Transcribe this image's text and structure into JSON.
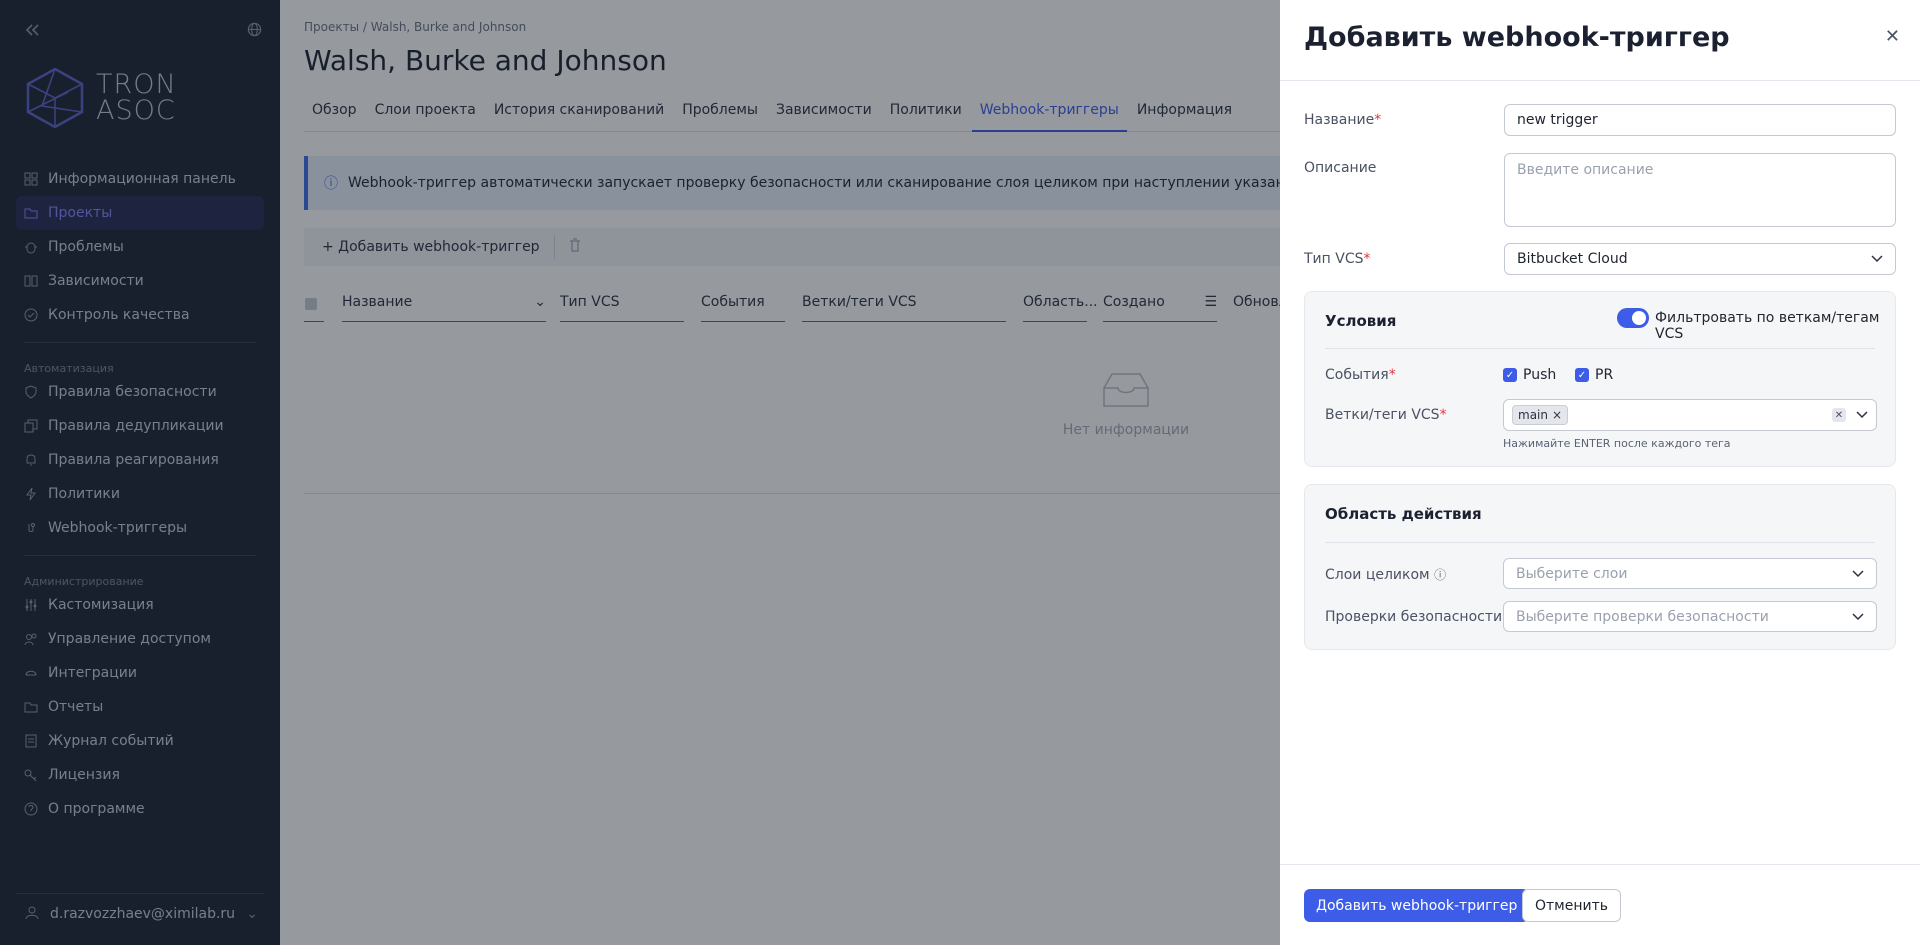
{
  "sidebar": {
    "collapse_icon": "double-chevron-left-icon",
    "language_icon": "globe-icon",
    "logo_text_1": "TRON",
    "logo_text_2": "ASOC",
    "items_top": [
      {
        "label": "Информационная панель",
        "icon": "dashboard-icon"
      },
      {
        "label": "Проекты",
        "icon": "folder-icon",
        "active": true
      },
      {
        "label": "Проблемы",
        "icon": "bug-icon"
      },
      {
        "label": "Зависимости",
        "icon": "book-icon"
      },
      {
        "label": "Контроль качества",
        "icon": "check-circle-icon"
      }
    ],
    "section_automation": "Автоматизация",
    "items_automation": [
      {
        "label": "Правила безопасности",
        "icon": "shield-icon"
      },
      {
        "label": "Правила дедупликации",
        "icon": "copy-icon"
      },
      {
        "label": "Правила реагирования",
        "icon": "bell-icon"
      },
      {
        "label": "Политики",
        "icon": "bolt-icon"
      },
      {
        "label": "Webhook-триггеры",
        "icon": "webhook-icon"
      }
    ],
    "section_admin": "Администрирование",
    "items_admin": [
      {
        "label": "Кастомизация",
        "icon": "sliders-icon"
      },
      {
        "label": "Управление доступом",
        "icon": "users-icon"
      },
      {
        "label": "Интеграции",
        "icon": "integration-icon"
      },
      {
        "label": "Отчеты",
        "icon": "folder-icon"
      },
      {
        "label": "Журнал событий",
        "icon": "list-icon"
      },
      {
        "label": "Лицензия",
        "icon": "key-icon"
      },
      {
        "label": "О программе",
        "icon": "help-circle-icon"
      }
    ],
    "user_email": "d.razvozzhaev@ximilab.ru"
  },
  "main": {
    "breadcrumb_root": "Проекты",
    "breadcrumb_sep": "/",
    "breadcrumb_current": "Walsh, Burke and Johnson",
    "title": "Walsh, Burke and Johnson",
    "tabs": [
      "Обзор",
      "Слои проекта",
      "История сканирований",
      "Проблемы",
      "Зависимости",
      "Политики",
      "Webhook-триггеры",
      "Информация"
    ],
    "active_tab": "Webhook-триггеры",
    "info_text": "Webhook-триггер автоматически запускает проверку безопасности или сканирование слоя целиком при наступлении указанных событий в VCS",
    "add_button": "+ Добавить webhook-триггер",
    "columns": [
      "Название",
      "Тип VCS",
      "События",
      "Ветки/теги VCS",
      "Область...",
      "Создано",
      "Обновл"
    ],
    "empty_text": "Нет информации"
  },
  "drawer": {
    "title": "Добавить webhook-триггер",
    "name_label": "Название",
    "name_value": "new trigger",
    "description_label": "Описание",
    "description_placeholder": "Введите описание",
    "vcs_type_label": "Тип VCS",
    "vcs_type_value": "Bitbucket Cloud",
    "conditions": {
      "title": "Условия",
      "filter_toggle_label": "Фильтровать по веткам/тегам VCS",
      "filter_toggle_on": true,
      "events_label": "События",
      "events": [
        {
          "label": "Push",
          "checked": true
        },
        {
          "label": "PR",
          "checked": true
        }
      ],
      "branches_label": "Ветки/теги VCS",
      "branch_tags": [
        "main"
      ],
      "branches_hint": "Нажимайте ENTER после каждого тега"
    },
    "scope": {
      "title": "Область действия",
      "layers_label": "Слои целиком",
      "layers_placeholder": "Выберите слои",
      "checks_label": "Проверки безопасности",
      "checks_placeholder": "Выберите проверки безопасности"
    },
    "submit_label": "Добавить webhook-триггер",
    "cancel_label": "Отменить"
  },
  "colors": {
    "accent": "#3d5ce8",
    "sidebar_bg": "#1b2334",
    "required": "#e0363c"
  }
}
